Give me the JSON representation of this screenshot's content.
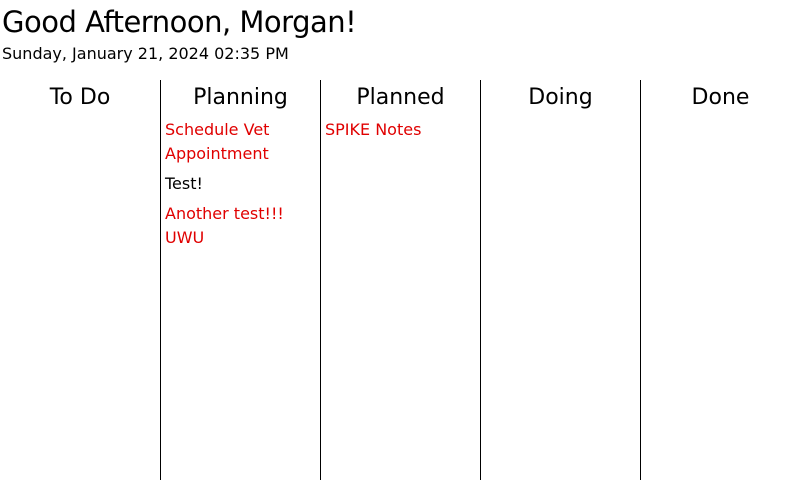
{
  "header": {
    "greeting": "Good Afternoon, Morgan!",
    "datetime": "Sunday, January 21, 2024 02:35 PM"
  },
  "colors": {
    "default_text": "#000000",
    "highlight_text": "#e00000",
    "divider": "#000000",
    "background": "#ffffff"
  },
  "columns": [
    {
      "title": "To Do",
      "cards": []
    },
    {
      "title": "Planning",
      "cards": [
        {
          "text": "Schedule Vet Appointment",
          "highlighted": true
        },
        {
          "text": "Test!",
          "highlighted": false
        },
        {
          "text": "Another test!!! UWU",
          "highlighted": true
        }
      ]
    },
    {
      "title": "Planned",
      "cards": [
        {
          "text": "SPIKE Notes",
          "highlighted": true
        }
      ]
    },
    {
      "title": "Doing",
      "cards": []
    },
    {
      "title": "Done",
      "cards": []
    }
  ]
}
